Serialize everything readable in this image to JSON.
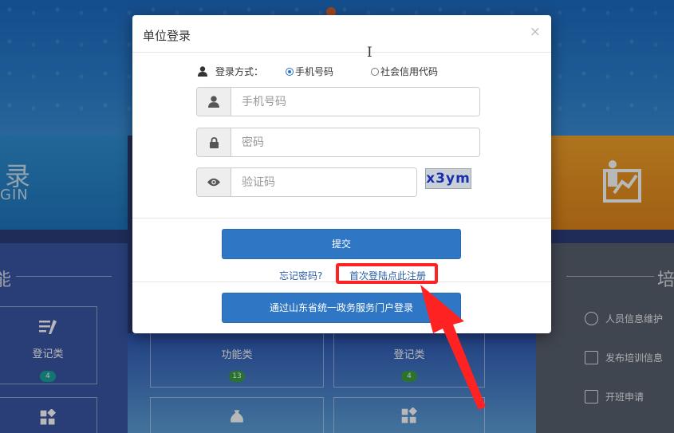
{
  "modal": {
    "title": "单位登录",
    "close_icon": "×",
    "login_mode": {
      "label": "登录方式：",
      "options": [
        {
          "label": "手机号码",
          "selected": true
        },
        {
          "label": "社会信用代码",
          "selected": false
        }
      ]
    },
    "phone": {
      "placeholder": "手机号码",
      "icon": "user-icon"
    },
    "password": {
      "placeholder": "密码",
      "icon": "lock-icon"
    },
    "captcha": {
      "placeholder": "验证码",
      "icon": "eye-icon",
      "image_text": "x3ym"
    },
    "submit_label": "提交",
    "forgot_label": "忘记密码?",
    "register_label": "首次登陆点此注册",
    "portal_login_label": "通过山东省统一政务服务门户登录",
    "highlight_color": "#ff2222"
  },
  "background": {
    "banner_left": {
      "char": "录",
      "sub": "GIN"
    },
    "section_left_char": "能",
    "section_right_char": "培",
    "tiles": [
      {
        "label": "登记类",
        "badge": "4",
        "badge_color": "#1aa39a"
      },
      {
        "label": "功能类",
        "badge": "13",
        "badge_color": "#3aa040"
      },
      {
        "label": "登记类",
        "badge": "4",
        "badge_color": "#3aa040"
      }
    ],
    "tile_icons": [
      "money-bag-icon",
      "grid-icon"
    ],
    "side_menu": [
      {
        "label": "人员信息维护",
        "icon": "person-circle-icon"
      },
      {
        "label": "发布培训信息",
        "icon": "board-icon"
      },
      {
        "label": "开班申请",
        "icon": "megaphone-icon"
      }
    ]
  }
}
